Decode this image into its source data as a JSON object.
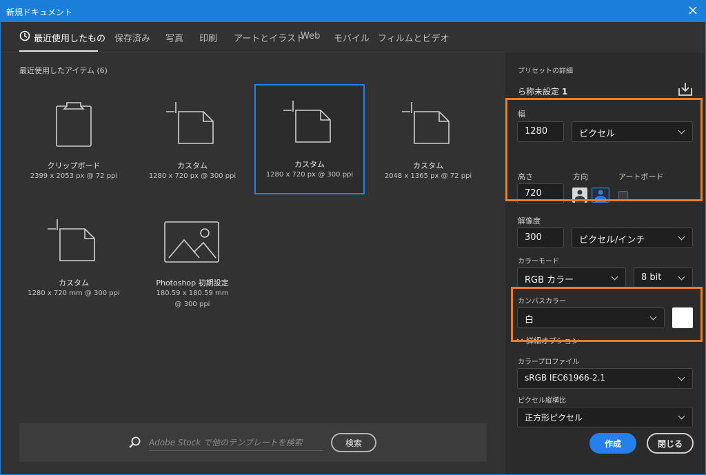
{
  "window": {
    "title": "新規ドキュメント"
  },
  "tabs": [
    {
      "label": "最近使用したもの",
      "active": true
    },
    {
      "label": "保存済み"
    },
    {
      "label": "写真"
    },
    {
      "label": "印刷"
    },
    {
      "label": "アートとイラスト"
    },
    {
      "label": "Web"
    },
    {
      "label": "モバイル"
    },
    {
      "label": "フィルムとビデオ"
    }
  ],
  "recent": {
    "heading": "最近使用したアイテム (6)",
    "items": [
      {
        "name": "クリップボード",
        "dims": "2399 x 2053 px @ 72 ppi",
        "icon": "clipboard-icon"
      },
      {
        "name": "カスタム",
        "dims": "1280 x 720 px @ 300 ppi",
        "icon": "document-icon"
      },
      {
        "name": "カスタム",
        "dims": "1280 x 720 px @ 300 ppi",
        "icon": "document-icon",
        "selected": true
      },
      {
        "name": "カスタム",
        "dims": "2048 x 1365 px @ 72 ppi",
        "icon": "document-icon"
      },
      {
        "name": "カスタム",
        "dims": "1280 x 720 mm @ 300 ppi",
        "icon": "document-icon"
      },
      {
        "name": "Photoshop 初期設定",
        "dims": "180.59 x 180.59 mm @ 300 ppi",
        "icon": "image-icon"
      }
    ]
  },
  "search": {
    "placeholder": "Adobe Stock で他のテンプレートを検索",
    "button": "検索"
  },
  "preset": {
    "heading": "プリセットの詳細",
    "name_prefix": "ら称未設定",
    "name_number": "1",
    "width_label": "幅",
    "width_value": "1280",
    "width_unit": "ピクセル",
    "height_label": "高さ",
    "height_value": "720",
    "orientation_label": "方向",
    "artboard_label": "アートボード",
    "resolution_label": "解像度",
    "resolution_value": "300",
    "resolution_unit": "ピクセル/インチ",
    "color_mode_label": "カラーモード",
    "color_mode_value": "RGB カラー",
    "bit_depth": "8 bit",
    "canvas_color_label": "カンバスカラー",
    "canvas_color_value": "白",
    "canvas_swatch": "#ffffff",
    "advanced_label": "詳細オプション",
    "color_profile_label": "カラープロファイル",
    "color_profile_value": "sRGB IEC61966-2.1",
    "pixel_aspect_label": "ピクセル縦横比",
    "pixel_aspect_value": "正方形ピクセル"
  },
  "actions": {
    "create": "作成",
    "close": "閉じる"
  },
  "colors": {
    "accent": "#2680eb",
    "titlebar": "#1b7fd9",
    "highlight": "#ee7d23",
    "panel": "#2b2b2b"
  }
}
